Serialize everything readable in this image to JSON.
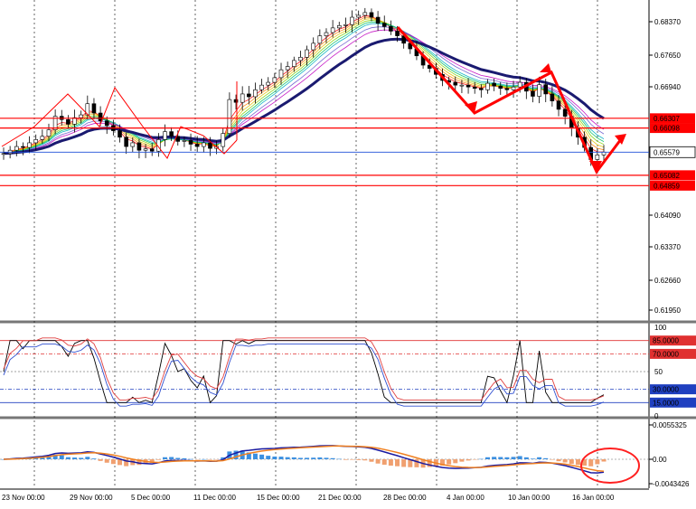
{
  "chart_data": [
    {
      "type": "candlestick",
      "panel": "price",
      "ylim": [
        0.6195,
        0.6885
      ],
      "y_ticks": [
        "0.68370",
        "0.67650",
        "0.66940",
        "0.64090",
        "0.63370",
        "0.62660",
        "0.61950"
      ],
      "horizontal_levels": [
        {
          "label": "0.66307",
          "value": 0.66307,
          "color": "#ff0000"
        },
        {
          "label": "0.66098",
          "value": 0.66098,
          "color": "#ff0000"
        },
        {
          "label": "0.65579",
          "value": 0.65579,
          "color": "#1f4fd8",
          "current": true
        },
        {
          "label": "0.65082",
          "value": 0.65082,
          "color": "#ff0000"
        },
        {
          "label": "0.64859",
          "value": 0.64859,
          "color": "#ff0000"
        }
      ],
      "ma_ribbon_colors": [
        "#ff0000",
        "#ff7f00",
        "#e6c200",
        "#7fd000",
        "#00c060",
        "#00b0c0",
        "#6a5acd",
        "#c000c0"
      ],
      "slow_ma_color": "#1a1a70",
      "close_path": [
        0.6555,
        0.6562,
        0.657,
        0.6568,
        0.6578,
        0.6585,
        0.6592,
        0.6606,
        0.6635,
        0.6628,
        0.6618,
        0.6632,
        0.6638,
        0.6662,
        0.6642,
        0.6625,
        0.6615,
        0.6604,
        0.659,
        0.657,
        0.6578,
        0.6562,
        0.6565,
        0.656,
        0.6585,
        0.6602,
        0.6592,
        0.6581,
        0.6583,
        0.6575,
        0.657,
        0.6578,
        0.6566,
        0.657,
        0.6598,
        0.6671,
        0.6665,
        0.6683,
        0.6677,
        0.6692,
        0.6702,
        0.6708,
        0.6718,
        0.6735,
        0.6742,
        0.6755,
        0.6762,
        0.6778,
        0.6792,
        0.6808,
        0.6815,
        0.6825,
        0.683,
        0.6832,
        0.6848,
        0.6852,
        0.6858,
        0.6848,
        0.6835,
        0.6828,
        0.6818,
        0.6808,
        0.6792,
        0.678,
        0.6765,
        0.6745,
        0.6738,
        0.6725,
        0.6712,
        0.6708,
        0.6702,
        0.6702,
        0.6698,
        0.6695,
        0.6692,
        0.6706,
        0.67,
        0.6695,
        0.6692,
        0.6698,
        0.6708,
        0.6689,
        0.6678,
        0.6703,
        0.6683,
        0.6668,
        0.665,
        0.6635,
        0.661,
        0.659,
        0.6568,
        0.6542,
        0.6552,
        0.6558
      ],
      "annotations": "red zigzag lines and arrows",
      "price_label_color": "#ff0000"
    },
    {
      "type": "line",
      "panel": "oscillator",
      "ylim": [
        0,
        100
      ],
      "y_ticks": [
        "100",
        "85.0000",
        "70.0000",
        "50",
        "30.0000",
        "15.0000",
        "0"
      ],
      "levels": [
        {
          "label": "85.0000",
          "value": 85,
          "color": "#e03030"
        },
        {
          "label": "70.0000",
          "value": 70,
          "color": "#e03030"
        },
        {
          "label": "30.0000",
          "value": 30,
          "color": "#2040c0"
        },
        {
          "label": "15.0000",
          "value": 15,
          "color": "#2040c0"
        }
      ],
      "series_colors": [
        "#000000",
        "#e04040",
        "#3050d0"
      ]
    },
    {
      "type": "bar",
      "panel": "macd",
      "y_ticks": [
        "0.0055325",
        "0.00",
        "-0.0043426"
      ],
      "hist_colors": {
        "positive": "#3b8fe0",
        "negative": "#f0a070"
      },
      "line_colors": [
        "#1a1aa0",
        "#f08020"
      ],
      "annotation": "red ellipse around latest histogram"
    }
  ],
  "x_axis": {
    "labels": [
      "23 Nov 00:00",
      "29 Nov 00:00",
      "5 Dec 00:00",
      "11 Dec 00:00",
      "15 Dec 00:00",
      "21 Dec 00:00",
      "28 Dec 00:00",
      "4 Jan 00:00",
      "10 Jan 00:00",
      "16 Jan 00:00"
    ]
  }
}
